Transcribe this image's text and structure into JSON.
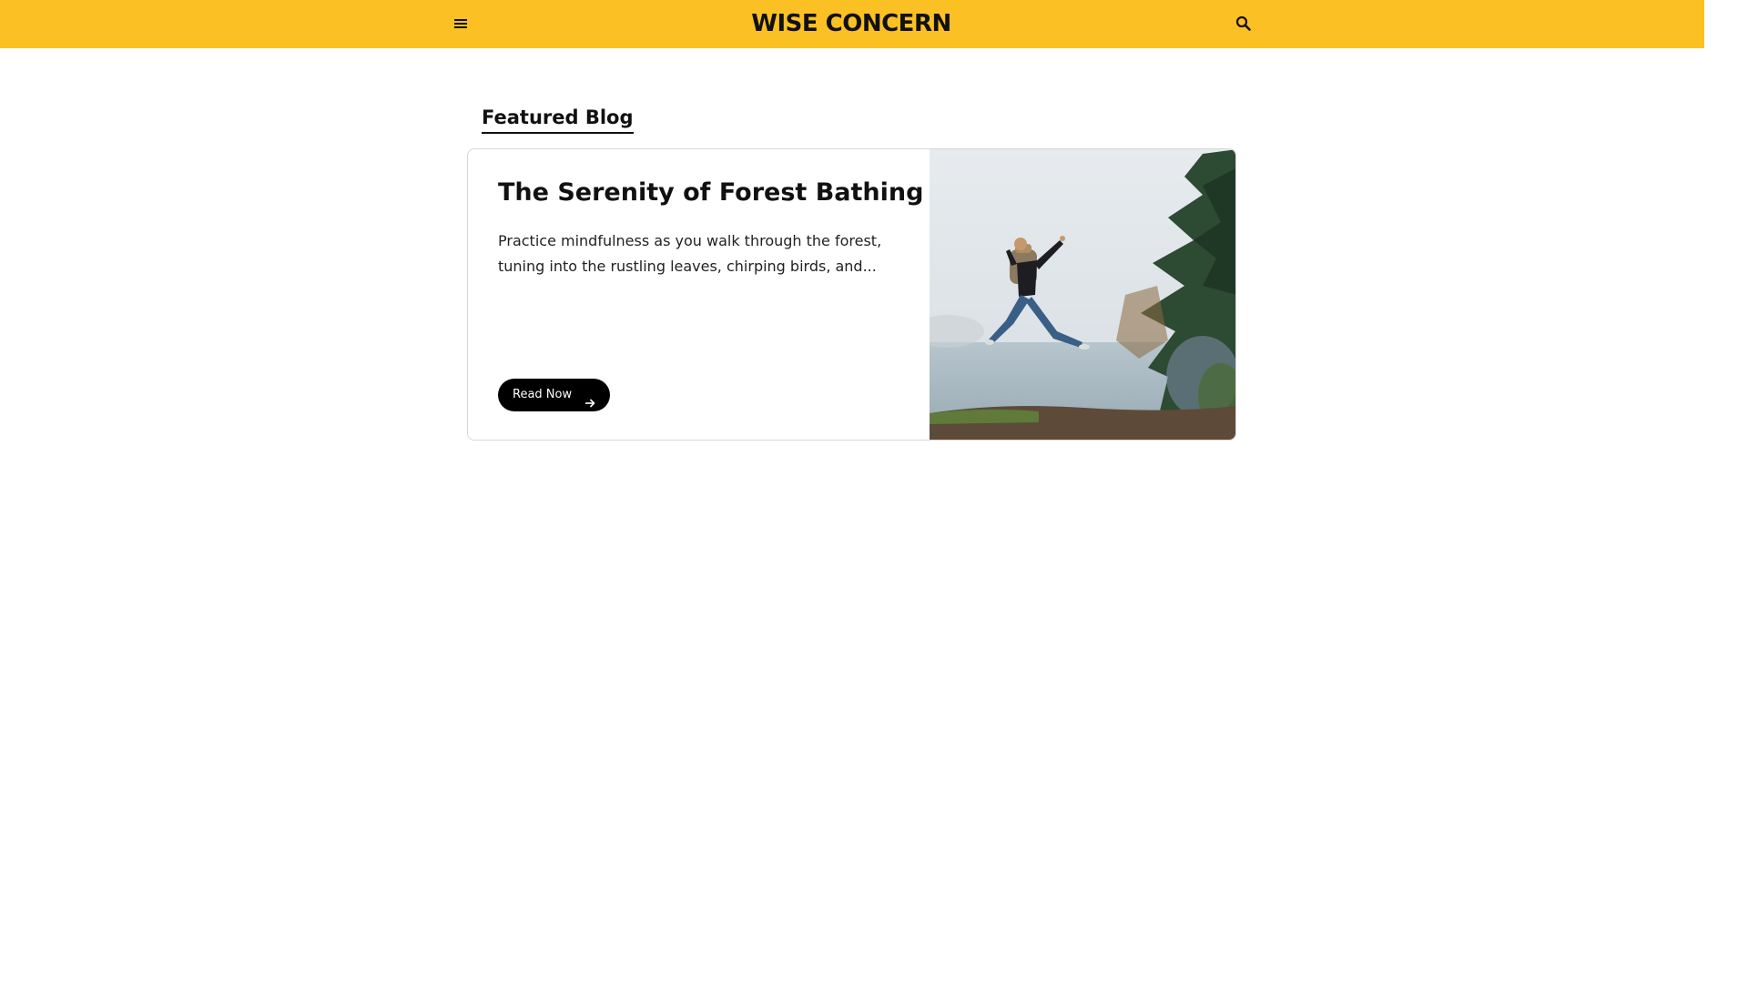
{
  "header": {
    "brand": "WISE CONCERN",
    "menu_icon": "hamburger-menu-icon",
    "search_icon": "search-icon",
    "background": "#fbc024"
  },
  "featured": {
    "section_title": "Featured Blog",
    "post": {
      "title": "The Serenity of Forest Bathing",
      "excerpt": "Practice mindfulness as you walk through the forest, tuning into the rustling leaves, chirping birds, and...",
      "button_label": "Read Now",
      "button_icon": "arrow-right-icon",
      "image": "person-jumping-by-lake-with-trees-photo"
    }
  }
}
